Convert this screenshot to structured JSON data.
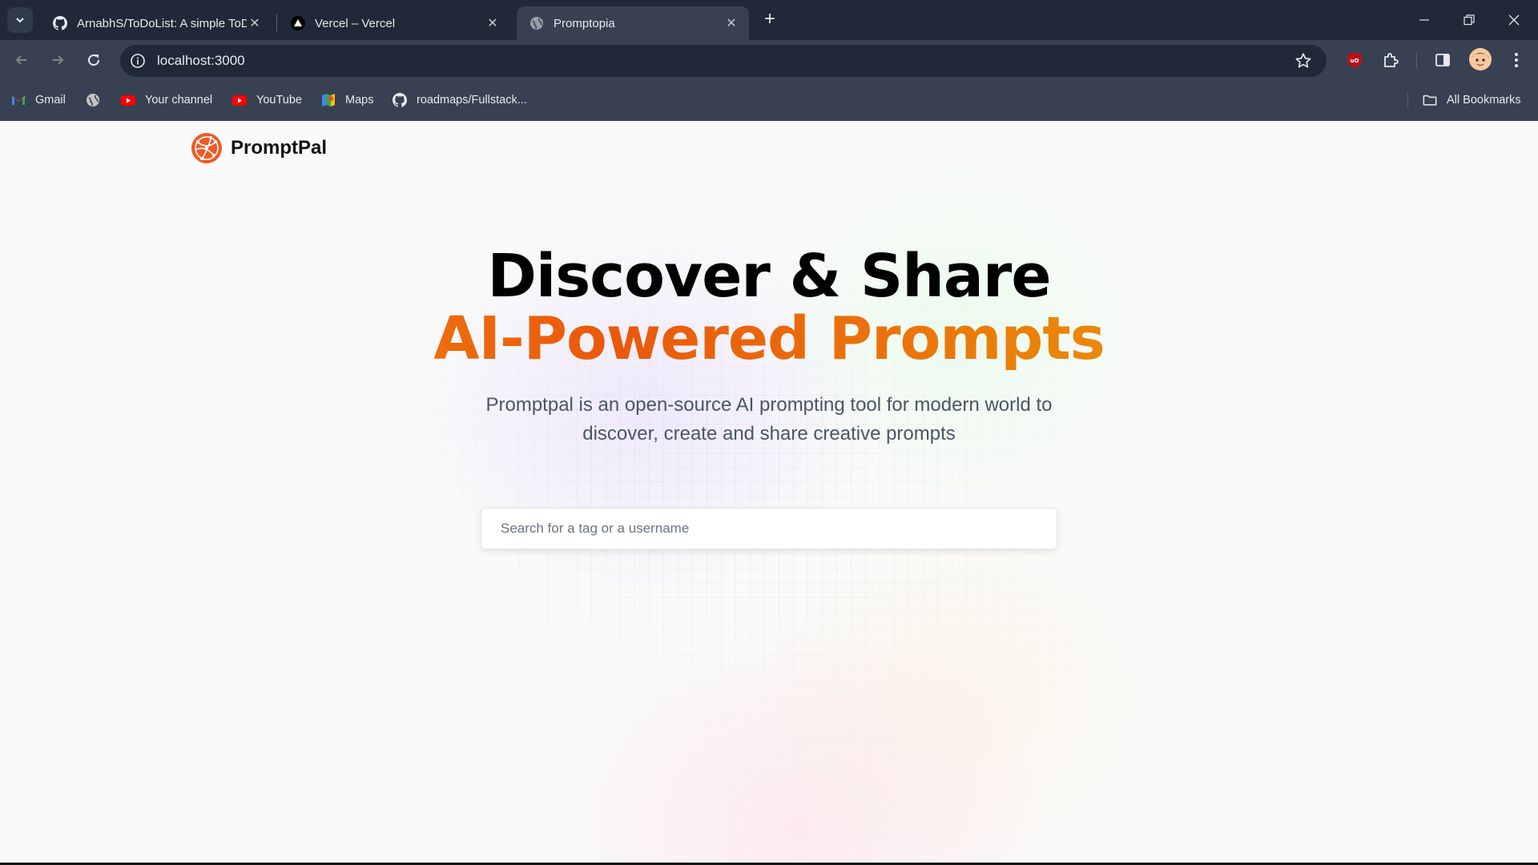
{
  "browser": {
    "tabs": [
      {
        "title": "ArnabhS/ToDoList: A simple ToDo",
        "active": false
      },
      {
        "title": "Vercel – Vercel",
        "active": false
      },
      {
        "title": "Promptopia",
        "active": true
      }
    ],
    "url": "localhost:3000",
    "bookmarks": [
      {
        "label": "Gmail"
      },
      {
        "label": ""
      },
      {
        "label": "Your channel"
      },
      {
        "label": "YouTube"
      },
      {
        "label": "Maps"
      },
      {
        "label": "roadmaps/Fullstack..."
      }
    ],
    "all_bookmarks_label": "All Bookmarks"
  },
  "page": {
    "logo_text": "PromptPal",
    "headline_line1": "Discover & Share",
    "headline_line2": "AI-Powered Prompts",
    "description": "Promptpal is an open-source AI prompting tool for modern world to discover, create and share creative prompts",
    "search_placeholder": "Search for a tag or a username"
  },
  "colors": {
    "chrome_dark": "#1f2937",
    "chrome_mid": "#374151",
    "accent_orange": "#ea580c",
    "accent_amber": "#f59e0b",
    "logo_orange": "#f05a28"
  }
}
